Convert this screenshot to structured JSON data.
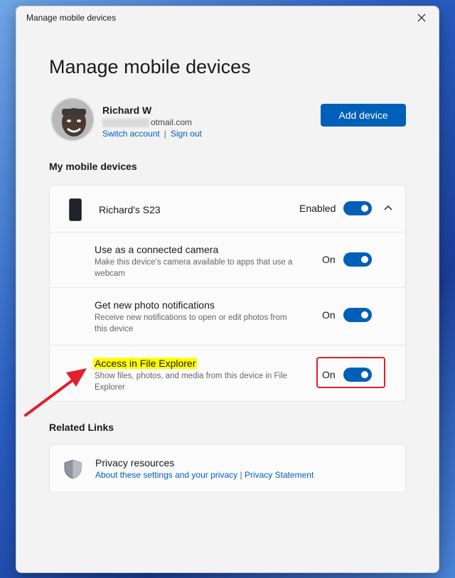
{
  "window": {
    "title": "Manage mobile devices",
    "close_icon": "close-icon"
  },
  "page": {
    "title": "Manage mobile devices"
  },
  "account": {
    "name": "Richard W",
    "email_visible": "otmail.com",
    "switch_label": "Switch account",
    "separator": "|",
    "signout_label": "Sign out",
    "add_device_label": "Add device"
  },
  "devices": {
    "heading": "My mobile devices",
    "device": {
      "name": "Richard's S23",
      "status": "Enabled",
      "enabled": true,
      "icon": "phone-icon",
      "expand_icon": "chevron-up-icon"
    },
    "settings": [
      {
        "title": "Use as a connected camera",
        "desc": "Make this device's camera available to apps that use a webcam",
        "state": "On",
        "on": true
      },
      {
        "title": "Get new photo notifications",
        "desc": "Receive new notifications to open or edit photos from this device",
        "state": "On",
        "on": true
      },
      {
        "title": "Access in File Explorer",
        "desc": "Show files, photos, and media from this device in File Explorer",
        "state": "On",
        "on": true,
        "highlighted": true
      }
    ]
  },
  "related": {
    "heading": "Related Links",
    "privacy": {
      "title": "Privacy resources",
      "link1": "About these settings and your privacy",
      "separator": "|",
      "link2": "Privacy Statement",
      "icon": "shield-icon"
    }
  },
  "colors": {
    "accent": "#005fb8",
    "annotation": "#e0202a",
    "highlight": "#ffff00"
  }
}
